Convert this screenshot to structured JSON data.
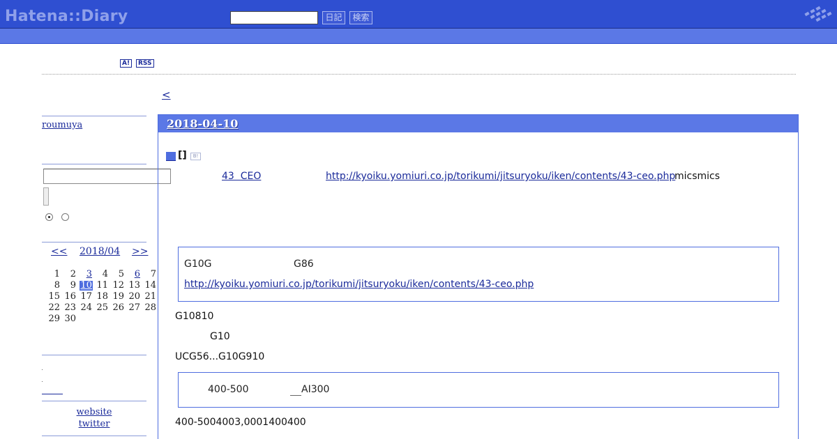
{
  "header": {
    "logo": "Hatena::Diary",
    "search_placeholder": "",
    "diary_button": "日記",
    "search_button": "検索"
  },
  "badges": {
    "antenna": "A!",
    "rss": "RSS"
  },
  "nav": {
    "prev": "<"
  },
  "sidebar": {
    "user": "roumuya",
    "calendar": {
      "prev": "<<",
      "month": "2018/04",
      "next": ">>",
      "weeks": [
        [
          {
            "d": "1"
          },
          {
            "d": "2"
          },
          {
            "d": "3",
            "link": true
          },
          {
            "d": "4"
          },
          {
            "d": "5"
          },
          {
            "d": "6",
            "link": true
          },
          {
            "d": "7"
          }
        ],
        [
          {
            "d": "8"
          },
          {
            "d": "9"
          },
          {
            "d": "10",
            "today": true
          },
          {
            "d": "11"
          },
          {
            "d": "12"
          },
          {
            "d": "13"
          },
          {
            "d": "14"
          }
        ],
        [
          {
            "d": "15"
          },
          {
            "d": "16"
          },
          {
            "d": "17"
          },
          {
            "d": "18"
          },
          {
            "d": "19"
          },
          {
            "d": "20"
          },
          {
            "d": "21"
          }
        ],
        [
          {
            "d": "22"
          },
          {
            "d": "23"
          },
          {
            "d": "24"
          },
          {
            "d": "25"
          },
          {
            "d": "26"
          },
          {
            "d": "27"
          },
          {
            "d": "28"
          }
        ],
        [
          {
            "d": "29"
          },
          {
            "d": "30"
          }
        ]
      ]
    },
    "links": {
      "website": "website",
      "twitter": "twitter"
    }
  },
  "entry": {
    "date": "2018-04-10",
    "section_bracket": "[]",
    "title_link": "43  CEO",
    "title_url": "http://kyoiku.yomiuri.co.jp/torikumi/jitsuryoku/iken/contents/43-ceo.php",
    "title_suffix": "micsmics",
    "quote1": {
      "text_a": "G10G",
      "text_b": "G86",
      "url": "http://kyoiku.yomiuri.co.jp/torikumi/jitsuryoku/iken/contents/43-ceo.php"
    },
    "para1": "G10810",
    "para2": "G10",
    "para3": "UCG56...G10G910",
    "quote2": {
      "text_a": "400-500",
      "text_b": "AI300"
    },
    "para4": "400-5004003,0001400400"
  }
}
